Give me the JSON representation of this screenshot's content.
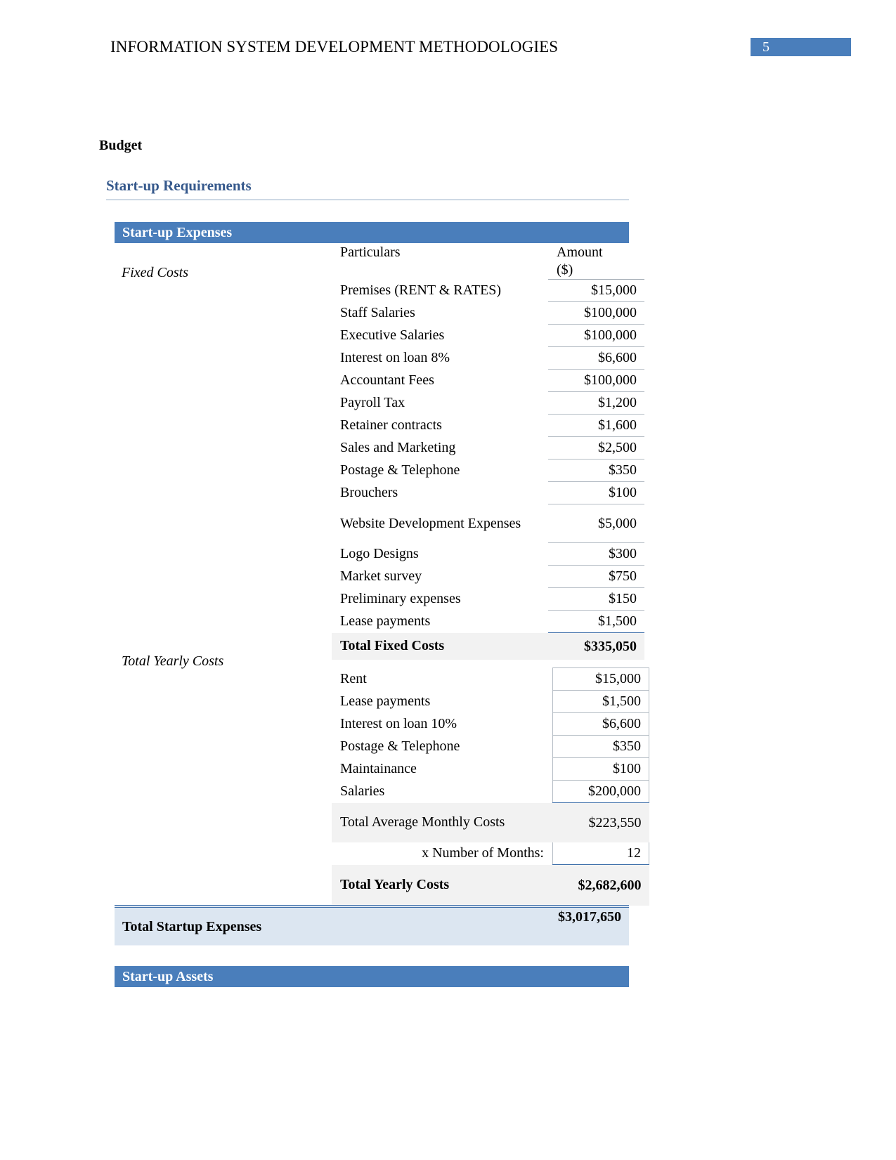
{
  "header": {
    "title": "INFORMATION SYSTEM DEVELOPMENT METHODOLOGIES",
    "page_number": "5",
    "accent_color": "#4a7ebb"
  },
  "sections": {
    "budget_heading": "Budget",
    "startup_requirements_heading": "Start-up Requirements",
    "startup_expenses_band": "Start-up Expenses",
    "startup_assets_band": "Start-up Assets"
  },
  "fixed_costs": {
    "side_label": "Fixed Costs",
    "columns": [
      "Particulars",
      "Amount ($)"
    ],
    "header_particulars": "Particulars",
    "header_amount_line1": "Amount",
    "header_amount_line2": "($)",
    "rows": [
      {
        "name": "Premises (RENT & RATES)",
        "amount": "$15,000"
      },
      {
        "name": "Staff Salaries",
        "amount": "$100,000"
      },
      {
        "name": "Executive Salaries",
        "amount": "$100,000"
      },
      {
        "name": "Interest on loan 8%",
        "amount": "$6,600"
      },
      {
        "name": "Accountant Fees",
        "amount": "$100,000"
      },
      {
        "name": "Payroll Tax",
        "amount": "$1,200"
      },
      {
        "name": "Retainer contracts",
        "amount": "$1,600"
      },
      {
        "name": "Sales and Marketing",
        "amount": "$2,500"
      },
      {
        "name": "Postage & Telephone",
        "amount": "$350"
      },
      {
        "name": "Brouchers",
        "amount": "$100"
      },
      {
        "name": "Website Development Expenses",
        "amount": "$5,000"
      },
      {
        "name": "Logo Designs",
        "amount": "$300"
      },
      {
        "name": "Market survey",
        "amount": "$750"
      },
      {
        "name": "Preliminary  expenses",
        "amount": "$150"
      },
      {
        "name": "Lease payments",
        "amount": "$1,500"
      }
    ],
    "total_label": "Total Fixed Costs",
    "total_amount": "$335,050"
  },
  "yearly_costs": {
    "side_label": "Total Yearly Costs",
    "rows": [
      {
        "name": "Rent",
        "amount": "$15,000"
      },
      {
        "name": "Lease payments",
        "amount": "$1,500"
      },
      {
        "name": "Interest on loan 10%",
        "amount": "$6,600"
      },
      {
        "name": "Postage & Telephone",
        "amount": "$350"
      },
      {
        "name": "Maintainance",
        "amount": "$100"
      },
      {
        "name": "Salaries",
        "amount": "$200,000"
      }
    ],
    "subtotal_label": "Total Average Monthly Costs",
    "subtotal_amount": "$223,550",
    "months_label": "x Number of Months:",
    "months_value": "12",
    "total_label": "Total Yearly Costs",
    "total_amount": "$2,682,600"
  },
  "grand_total": {
    "label": "Total Startup Expenses",
    "amount": "$3,017,650"
  }
}
